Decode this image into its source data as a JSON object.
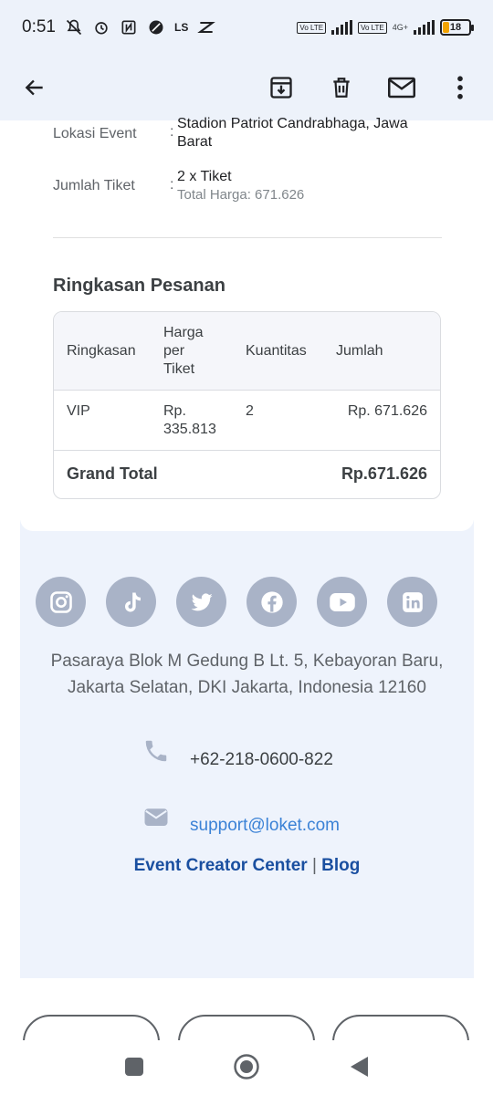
{
  "status": {
    "time": "0:51",
    "left_icons": [
      "mute-icon",
      "alarm-icon",
      "nfc-icon",
      "dnd-icon",
      "ls-icon",
      "app-icon"
    ],
    "ls_text": "LS",
    "volte1": "Vo LTE",
    "volte2": "Vo LTE",
    "net": "4G+",
    "battery": "18"
  },
  "toolbar": {
    "back": "back-arrow-icon",
    "archive": "archive-icon",
    "delete": "trash-icon",
    "mail": "mail-icon",
    "more": "more-vert-icon"
  },
  "details": {
    "location_label": "Lokasi Event",
    "location_value": "Stadion Patriot Candrabhaga, Jawa Barat",
    "tickets_label": "Jumlah Tiket",
    "tickets_value": "2 x Tiket",
    "tickets_total": "Total Harga: 671.626",
    "colon": ":"
  },
  "summary": {
    "title": "Ringkasan Pesanan",
    "headers": [
      "Ringkasan",
      "Harga per Tiket",
      "Kuantitas",
      "Jumlah"
    ],
    "rows": [
      {
        "name": "VIP",
        "price": "Rp. 335.813",
        "qty": "2",
        "amount": "Rp. 671.626"
      }
    ],
    "grand_total_label": "Grand Total",
    "grand_total_value": "Rp.671.626"
  },
  "footer": {
    "social": [
      "instagram-icon",
      "tiktok-icon",
      "twitter-icon",
      "facebook-icon",
      "youtube-icon",
      "linkedin-icon"
    ],
    "address_line1": "Pasaraya Blok M Gedung B Lt. 5, Kebayoran Baru,",
    "address_line2": "Jakarta Selatan, DKI Jakarta, Indonesia 12160",
    "phone": "+62-218-0600-822",
    "email": "support@loket.com",
    "link1": "Event Creator Center",
    "separator": "|",
    "link2": "Blog"
  },
  "colors": {
    "header_bg": "#edf2fa",
    "footer_bg": "#eef3fc",
    "social_bg": "#a9b3c7",
    "link_blue": "#1a4fa0",
    "email_blue": "#3b82d6"
  }
}
